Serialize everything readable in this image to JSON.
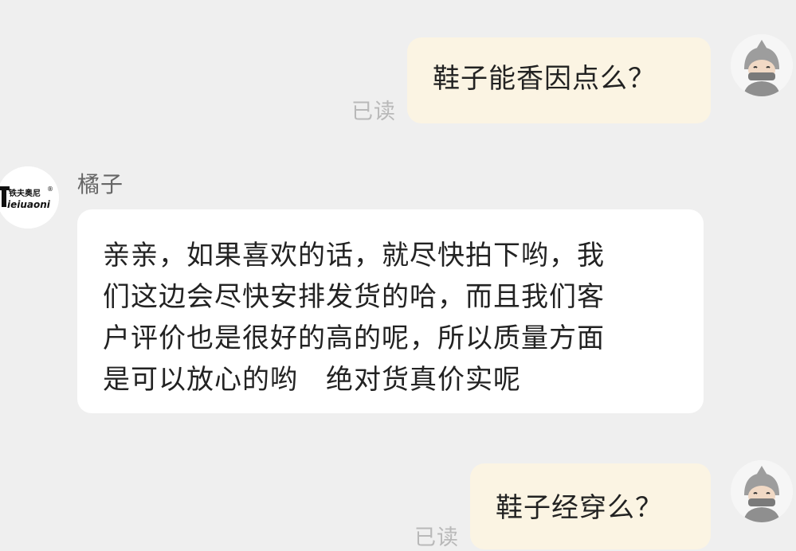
{
  "messages": [
    {
      "direction": "outgoing",
      "text": "鞋子能香因点么？",
      "status": "已读"
    },
    {
      "direction": "incoming",
      "sender": "橘子",
      "text": "亲亲，如果喜欢的话，就尽快拍下哟，我\n们这边会尽快安排发货的哈，而且我们客\n户评价也是很好的高的呢，所以质量方面\n是可以放心的哟　绝对货真价实呢"
    },
    {
      "direction": "outgoing",
      "text": "鞋子经穿么？",
      "status": "已读"
    }
  ],
  "brand": {
    "name_cn": "铁夫奥尼",
    "name_en": "ieiuaoni",
    "mark": "®"
  },
  "colors": {
    "background": "#efefef",
    "outgoing_bubble": "#fbf4e3",
    "incoming_bubble": "#ffffff",
    "read_status": "#b9b9b9"
  },
  "icons": [
    "user-avatar-icon",
    "brand-logo-icon"
  ]
}
